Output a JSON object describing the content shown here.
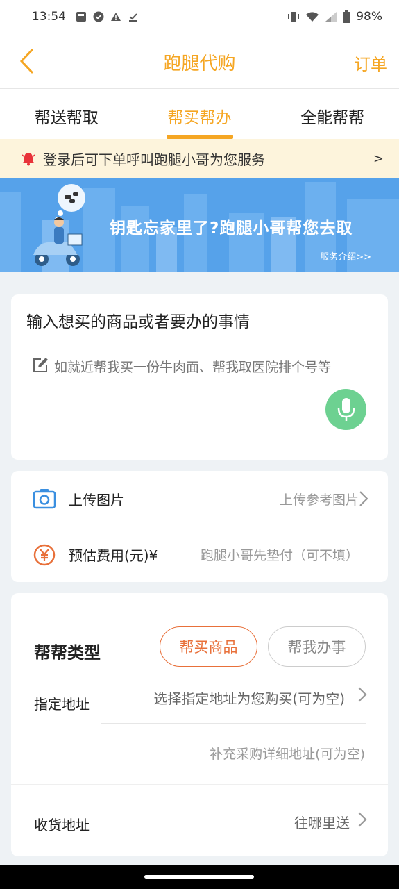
{
  "status_bar": {
    "time": "13:54",
    "battery": "98%"
  },
  "header": {
    "title": "跑腿代购",
    "order_link": "订单"
  },
  "tabs": [
    {
      "label": "帮送帮取",
      "active": false
    },
    {
      "label": "帮买帮办",
      "active": true
    },
    {
      "label": "全能帮帮",
      "active": false
    }
  ],
  "notice": {
    "text": "登录后可下单呼叫跑腿小哥为您服务",
    "arrow": ">"
  },
  "banner": {
    "title": "钥匙忘家里了?跑腿小哥帮您去取",
    "link": "服务介绍>>"
  },
  "request_card": {
    "heading": "输入想买的商品或者要办的事情",
    "placeholder": "如就近帮我买一份牛肉面、帮我取医院排个号等"
  },
  "extras_card": {
    "upload_label": "上传图片",
    "upload_value": "上传参考图片",
    "fee_label": "预估费用(元)¥",
    "fee_placeholder": "跑腿小哥先垫付（可不填）"
  },
  "type_card": {
    "type_label": "帮帮类型",
    "options": [
      "帮买商品",
      "帮我办事"
    ],
    "selected_option": "帮买商品",
    "address_label": "指定地址",
    "address_value": "选择指定地址为您购买(可为空)",
    "address_detail": "补充采购详细地址(可为空)",
    "receive_label": "收货地址",
    "receive_value": "往哪里送"
  },
  "colors": {
    "accent": "#f5a623",
    "accent_orange": "#e8703a",
    "banner_blue": "#56a2ea",
    "mic_green": "#6dd191",
    "notice_bg": "#fdf4dc"
  }
}
